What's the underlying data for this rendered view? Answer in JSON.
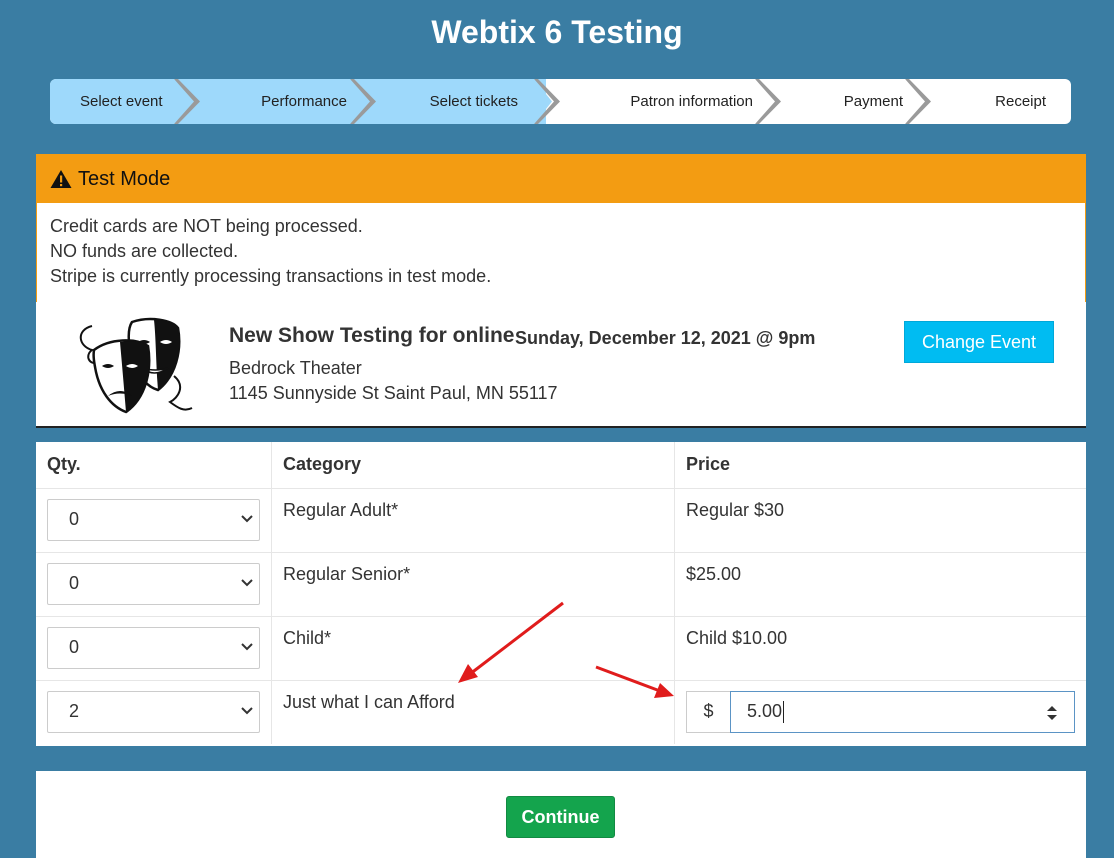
{
  "site": {
    "title": "Webtix 6 Testing"
  },
  "steps": [
    {
      "label": "Select event",
      "state": "done"
    },
    {
      "label": "Performance",
      "state": "done"
    },
    {
      "label": "Select tickets",
      "state": "current"
    },
    {
      "label": "Patron information",
      "state": "pending"
    },
    {
      "label": "Payment",
      "state": "pending"
    },
    {
      "label": "Receipt",
      "state": "pending"
    }
  ],
  "alert": {
    "icon": "warning-icon",
    "title": "Test Mode",
    "lines": [
      "Credit cards are NOT being processed.",
      "NO funds are collected.",
      "Stripe is currently processing transactions in test mode."
    ]
  },
  "event": {
    "image": "theater-masks",
    "name": "New Show Testing for online",
    "date": "Sunday, December 12, 2021 @ 9pm",
    "venue": "Bedrock Theater",
    "address": "1145 Sunnyside St Saint Paul, MN 55117",
    "change_label": "Change Event"
  },
  "tickets": {
    "headers": {
      "qty": "Qty.",
      "category": "Category",
      "price": "Price"
    },
    "rows": [
      {
        "qty": "0",
        "category": "Regular Adult*",
        "price": "Regular $30"
      },
      {
        "qty": "0",
        "category": "Regular Senior*",
        "price": "$25.00"
      },
      {
        "qty": "0",
        "category": "Child*",
        "price": "Child $10.00"
      },
      {
        "qty": "2",
        "category": "Just what I can Afford",
        "price_prefix": "$",
        "price_value": "5.00"
      }
    ]
  },
  "continue_label": "Continue",
  "colors": {
    "background": "#3a7da3",
    "step_done": "#9ed9fb",
    "alert": "#f39c12",
    "change_button": "#00bcf2",
    "continue_button": "#14a44d",
    "annotation_arrow": "#e01c1c"
  }
}
